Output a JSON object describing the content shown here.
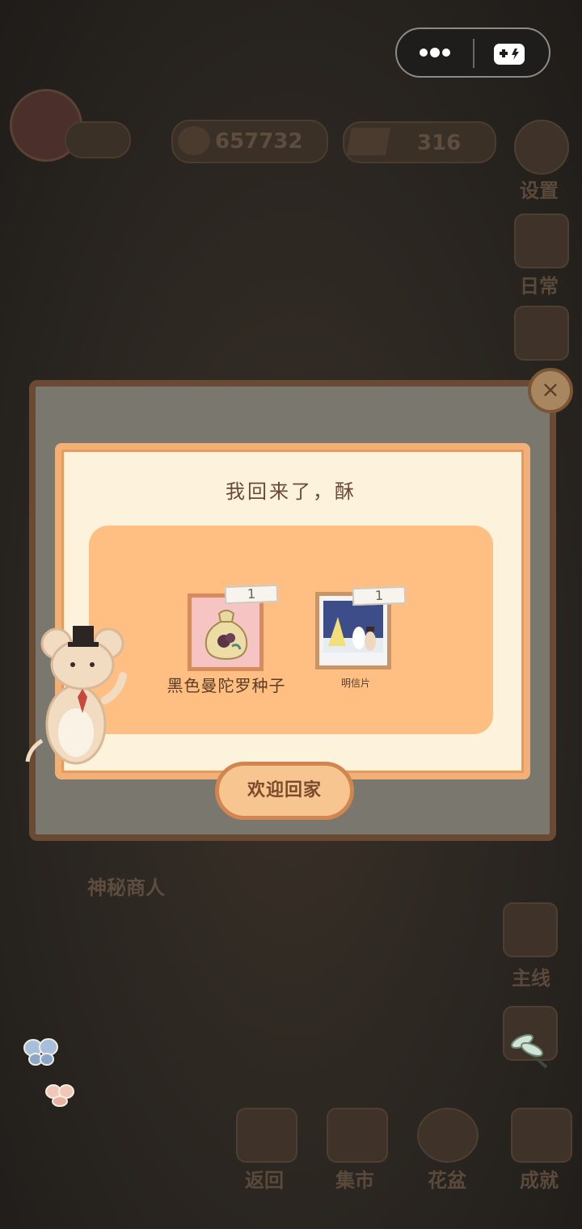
{
  "top_bar": {
    "fish_count": "657732",
    "cheese_count": "316"
  },
  "side_menu": {
    "settings_label": "设置",
    "daily_label": "日常",
    "main_quest_label": "主线"
  },
  "background": {
    "mysterious_merchant_label": "神秘商人"
  },
  "bottom_nav": {
    "items": [
      {
        "label": "返回"
      },
      {
        "label": "集市"
      },
      {
        "label": "花盆"
      },
      {
        "label": "成就"
      }
    ]
  },
  "dialog": {
    "title": "我回来了，酥",
    "close_symbol": "×",
    "rewards": [
      {
        "name": "黑色曼陀罗种子",
        "count": "1",
        "icon": "seed-bag-icon"
      },
      {
        "name": "明信片",
        "count": "1",
        "icon": "postcard-icon"
      }
    ],
    "confirm_button": "欢迎回家"
  },
  "colors": {
    "dialog_frame": "#f2b077",
    "reward_panel": "#ffbe82",
    "paper": "#fdf3dc",
    "button_fill": "#f7c58f"
  }
}
